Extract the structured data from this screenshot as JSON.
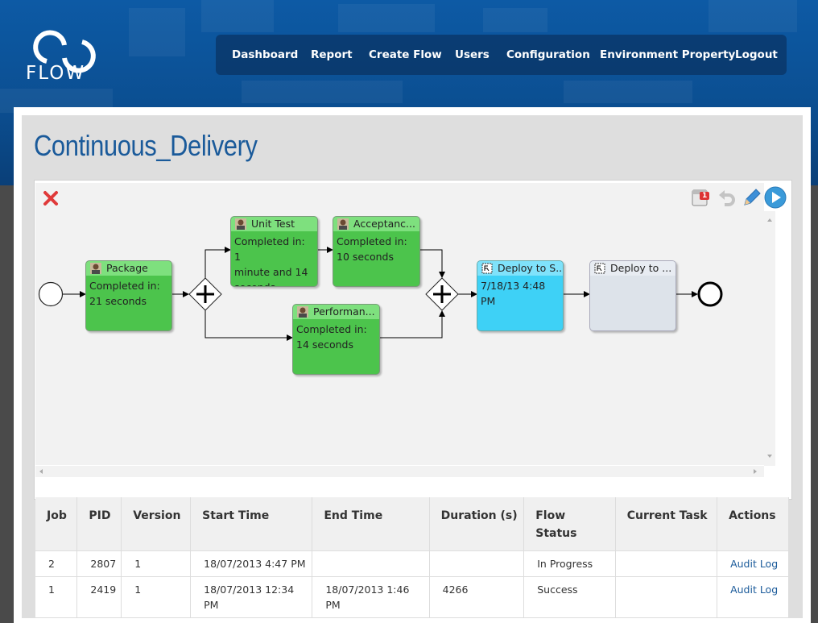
{
  "nav": {
    "items": [
      "Dashboard",
      "Report",
      "Create Flow",
      "Users",
      "Configuration",
      "Environment Property",
      "Logout"
    ]
  },
  "logo": {
    "text": "FLOW"
  },
  "page": {
    "title": "Continuous_Delivery"
  },
  "toolbar": {
    "notification_count": "1"
  },
  "diagram": {
    "tasks": [
      {
        "name": "Package",
        "body_lines": [
          "Completed in:",
          "21 seconds"
        ],
        "status": "completed",
        "color": "#4cc44c"
      },
      {
        "name": "Unit Test",
        "body_lines": [
          "Completed in: 1",
          "minute and 14",
          "seconds"
        ],
        "status": "completed",
        "color": "#4cc44c"
      },
      {
        "name": "Acceptanc...",
        "body_lines": [
          "Completed in:",
          "10 seconds"
        ],
        "status": "completed",
        "color": "#4cc44c"
      },
      {
        "name": "Performan...",
        "body_lines": [
          "Completed in:",
          "14 seconds"
        ],
        "status": "completed",
        "color": "#4cc44c"
      },
      {
        "name": "Deploy to S...",
        "body_lines": [
          "7/18/13 4:48",
          "PM"
        ],
        "status": "running",
        "color": "#3ed1f6"
      },
      {
        "name": "Deploy to ...",
        "body_lines": [],
        "status": "pending",
        "color": "#dde3ea"
      }
    ]
  },
  "jobs_table": {
    "columns": [
      "Job",
      "PID",
      "Version",
      "Start Time",
      "End Time",
      "Duration (s)",
      "Flow Status",
      "Current Task",
      "Actions"
    ],
    "rows": [
      {
        "job": "2",
        "pid": "2807",
        "version": "1",
        "start_time": "18/07/2013 4:47 PM",
        "end_time": "",
        "duration": "",
        "status": "In Progress",
        "current_task": "",
        "action": "Audit Log"
      },
      {
        "job": "1",
        "pid": "2419",
        "version": "1",
        "start_time": "18/07/2013 12:34 PM",
        "end_time": "18/07/2013 1:46 PM",
        "duration": "4266",
        "status": "Success",
        "current_task": "",
        "action": "Audit Log"
      }
    ]
  }
}
